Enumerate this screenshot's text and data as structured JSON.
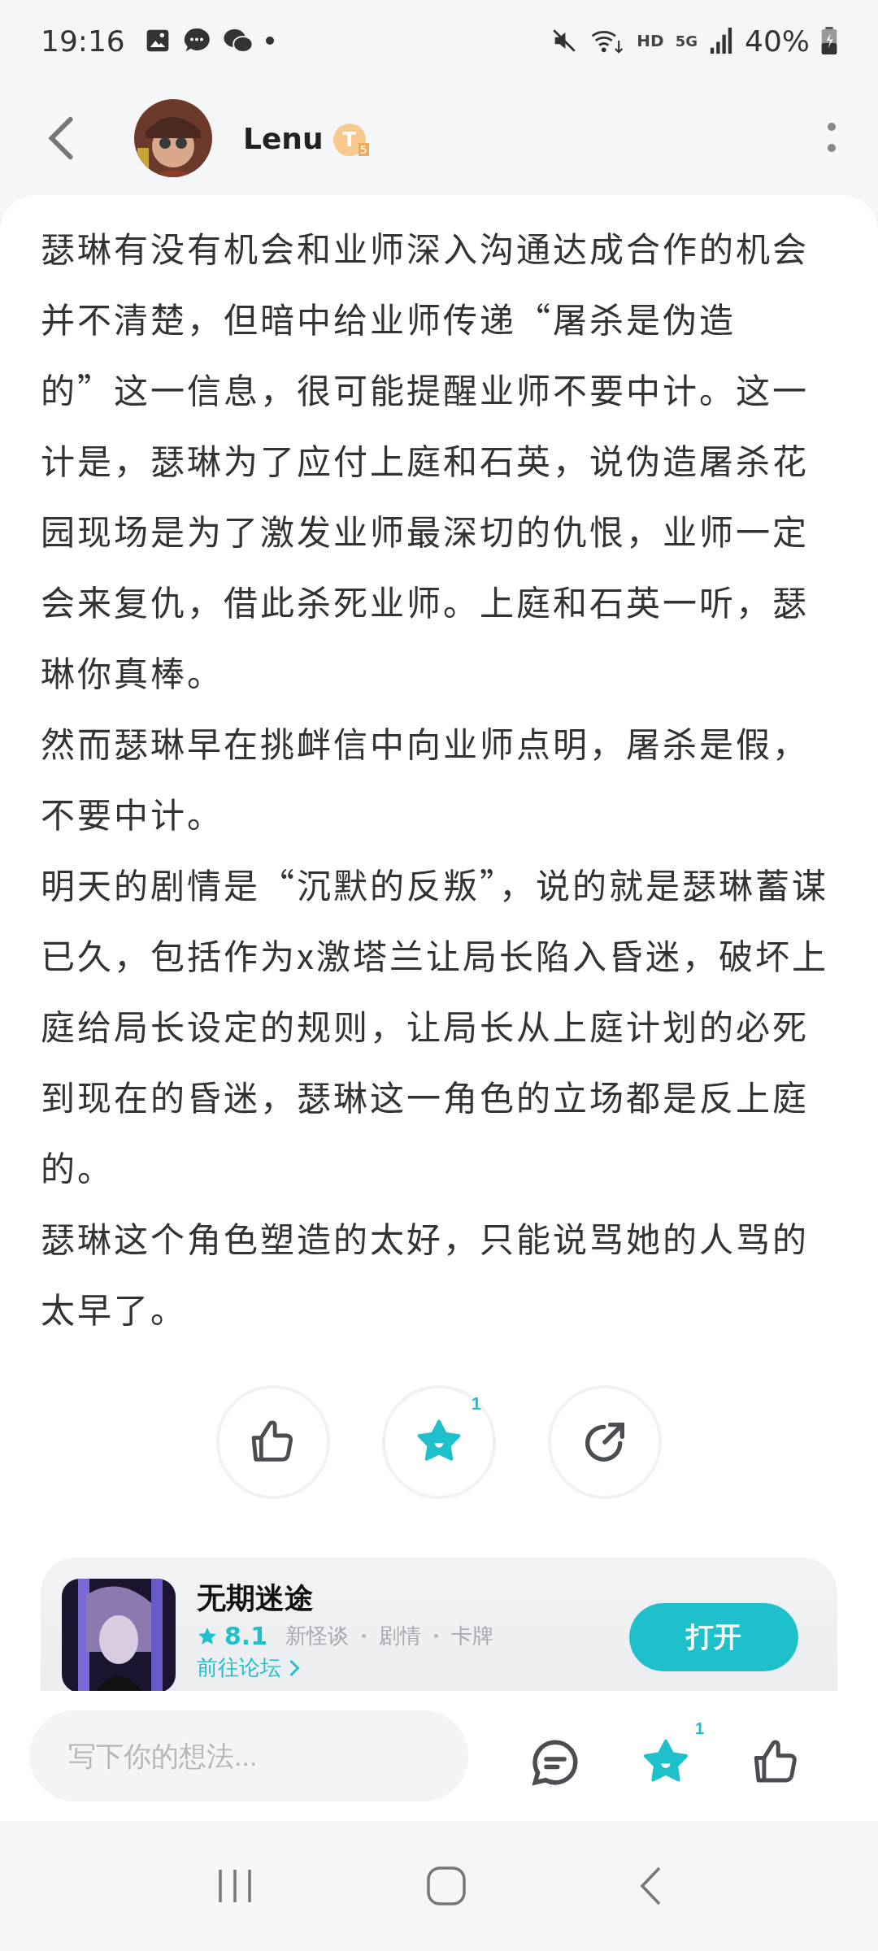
{
  "status_bar": {
    "time": "19:16",
    "battery": "40%",
    "network": "5G",
    "hd": "HD"
  },
  "header": {
    "author": "Lenu",
    "badge": "T",
    "badge_sub": "5",
    "avatar": {
      "kind": "picture"
    }
  },
  "paragraphs": [
    "瑟琳有没有机会和业师深入沟通达成合作的机会并不清楚，但暗中给业师传递“屠杀是伪造的”这一信息，很可能提醒业师不要中计。这一计是，瑟琳为了应付上庭和石英，说伪造屠杀花园现场是为了激发业师最深切的仇恨，业师一定会来复仇，借此杀死业师。上庭和石英一听，瑟琳你真棒。",
    "然而瑟琳早在挑衅信中向业师点明，屠杀是假，不要中计。",
    "明天的剧情是“沉默的反叛”，说的就是瑟琳蓄谋已久，包括作为x激塔兰让局长陷入昏迷，破坏上庭给局长设定的规则，让局长从上庭计划的必死到现在的昏迷，瑟琳这一角色的立场都是反上庭的。",
    "瑟琳这个角色塑造的太好，只能说骂她的人骂的太早了。"
  ],
  "actions": [
    {
      "kind": "like",
      "selected": false
    },
    {
      "kind": "collect",
      "selected": true,
      "count": "1"
    },
    {
      "kind": "share",
      "selected": false
    }
  ],
  "game_card": {
    "name": "无期迷途",
    "rating": "8.1",
    "tags": [
      "新怪谈",
      "剧情",
      "卡牌"
    ],
    "link": "前往论坛",
    "button": "打开",
    "icon": {
      "kind": "picture"
    }
  },
  "bottom_bar": {
    "placeholder": "写下你的想法...",
    "actions": [
      {
        "kind": "comment",
        "selected": false
      },
      {
        "kind": "collect",
        "selected": true,
        "count": "1"
      },
      {
        "kind": "like",
        "selected": false
      }
    ]
  }
}
